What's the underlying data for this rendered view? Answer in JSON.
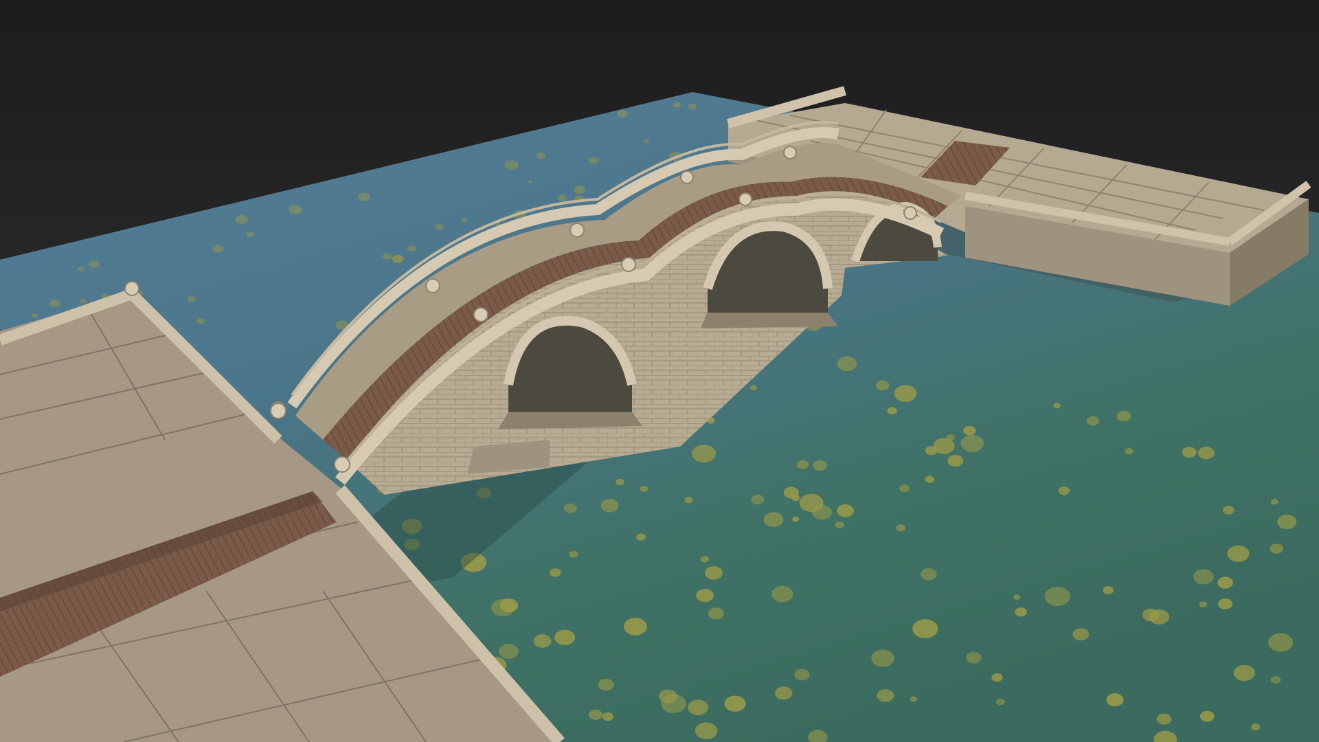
{
  "scene": {
    "subject": "stone-arch-bridge-3d-render",
    "colors": {
      "background_top": "#1c1c1c",
      "background_bottom": "#3a3a3a",
      "water_far": "#4d7890",
      "water_near": "#3f7263",
      "lily_pad": "#9a9a48",
      "stone_paving": "#a89a86",
      "stone_light": "#c9bda6",
      "stone_wall": "#b3a68e",
      "wood_plank": "#7a5a48",
      "arch_shadow": "#4c4a3e"
    },
    "elements": [
      "left-stone-pier",
      "right-stone-pier",
      "wooden-walkway",
      "arched-bridge",
      "bridge-railing",
      "lily-pads",
      "water-surface"
    ]
  }
}
